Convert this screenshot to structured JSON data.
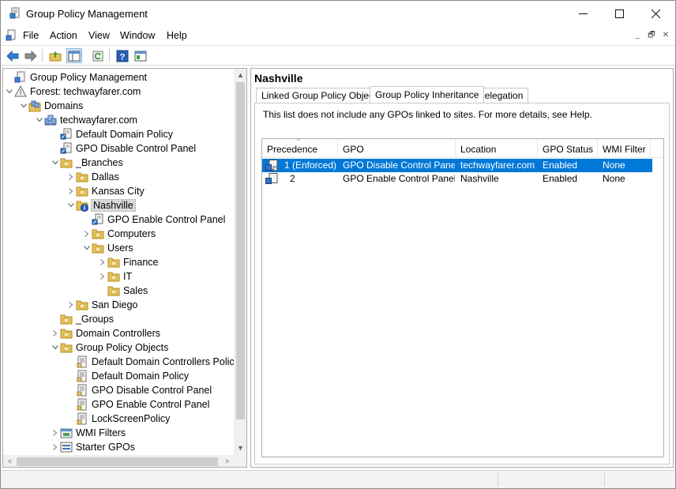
{
  "window": {
    "title": "Group Policy Management",
    "controls": {
      "minimize": "—",
      "maximize": "☐",
      "close": "✕"
    }
  },
  "menubar": {
    "items": [
      "File",
      "Action",
      "View",
      "Window",
      "Help"
    ],
    "mdi": {
      "minimize": "_",
      "restore": "🗗",
      "close": "✕"
    }
  },
  "toolbar": {
    "buttons": [
      "back-arrow-icon",
      "forward-arrow-icon",
      "folder-up-icon",
      "show-hide-tree-icon",
      "refresh-icon",
      "help-icon",
      "properties-icon"
    ]
  },
  "tree": {
    "root": "Group Policy Management",
    "forest": "Forest: techwayfarer.com",
    "domains": "Domains",
    "domain": "techwayfarer.com",
    "items": [
      {
        "label": "Default Domain Policy",
        "icon": "gpo-link-icon"
      },
      {
        "label": "GPO Disable Control Panel",
        "icon": "gpo-link-icon"
      },
      {
        "label": "_Branches",
        "icon": "ou-folder-icon",
        "expanded": true
      },
      {
        "label": "Dallas",
        "icon": "ou-folder-icon"
      },
      {
        "label": "Kansas City",
        "icon": "ou-folder-icon"
      },
      {
        "label": "Nashville",
        "icon": "ou-folder-icon",
        "selected": true,
        "expanded": true
      },
      {
        "label": "GPO Enable Control Panel",
        "icon": "gpo-link-icon"
      },
      {
        "label": "Computers",
        "icon": "ou-folder-icon"
      },
      {
        "label": "Users",
        "icon": "ou-folder-icon",
        "expanded": true
      },
      {
        "label": "Finance",
        "icon": "ou-folder-icon"
      },
      {
        "label": "IT",
        "icon": "ou-folder-icon"
      },
      {
        "label": "Sales",
        "icon": "ou-folder-icon"
      },
      {
        "label": "San Diego",
        "icon": "ou-folder-icon"
      },
      {
        "label": "_Groups",
        "icon": "ou-folder-icon"
      },
      {
        "label": "Domain Controllers",
        "icon": "ou-folder-icon"
      },
      {
        "label": "Group Policy Objects",
        "icon": "ou-folder-icon",
        "expanded": true
      },
      {
        "label": "Default Domain Controllers Policy",
        "icon": "gpo-icon"
      },
      {
        "label": "Default Domain Policy",
        "icon": "gpo-icon"
      },
      {
        "label": "GPO Disable Control Panel",
        "icon": "gpo-icon"
      },
      {
        "label": "GPO Enable Control Panel",
        "icon": "gpo-icon"
      },
      {
        "label": "LockScreenPolicy",
        "icon": "gpo-icon"
      },
      {
        "label": "WMI Filters",
        "icon": "wmi-filter-icon"
      },
      {
        "label": "Starter GPOs",
        "icon": "starter-gpo-icon"
      }
    ]
  },
  "details": {
    "title": "Nashville",
    "tabs": [
      "Linked Group Policy Objects",
      "Group Policy Inheritance",
      "Delegation"
    ],
    "active_tab": "Group Policy Inheritance",
    "info": "This list does not include any GPOs linked to sites. For more details, see Help.",
    "columns": [
      "Precedence",
      "GPO",
      "Location",
      "GPO Status",
      "WMI Filter"
    ],
    "rows": [
      {
        "precedence": "1  (Enforced)",
        "gpo": "GPO Disable Control Panel",
        "location": "techwayfarer.com",
        "status": "Enabled",
        "wmi": "None",
        "selected": true
      },
      {
        "precedence": "2",
        "gpo": "GPO Enable Control Panel",
        "location": "Nashville",
        "status": "Enabled",
        "wmi": "None",
        "selected": false
      }
    ]
  },
  "scroll": {
    "up": "▲",
    "down": "▼",
    "left": "<",
    "right": ">"
  },
  "colors": {
    "selection": "#0078d7",
    "folder": "#e8c25a"
  }
}
